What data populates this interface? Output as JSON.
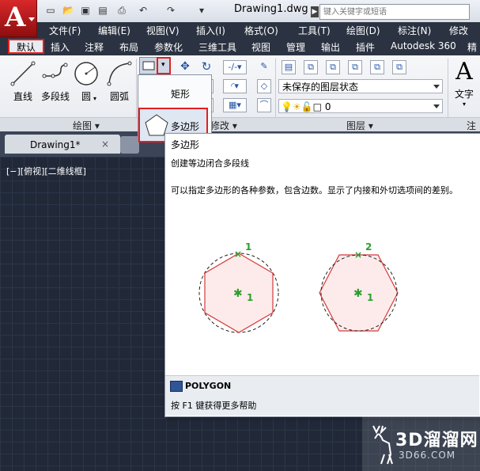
{
  "app": {
    "logo_letter": "A"
  },
  "title_bar": {
    "document_title": "Drawing1.dwg",
    "search_placeholder": "键入关键字或短语"
  },
  "menu": [
    "文件(F)",
    "编辑(E)",
    "视图(V)",
    "插入(I)",
    "格式(O)",
    "工具(T)",
    "绘图(D)",
    "标注(N)",
    "修改(M)"
  ],
  "ribbon_tabs": {
    "active": "默认",
    "others": [
      "插入",
      "注释",
      "布局",
      "参数化",
      "三维工具",
      "视图",
      "管理",
      "输出",
      "插件",
      "Autodesk 360",
      "精"
    ]
  },
  "draw_tools": [
    "直线",
    "多段线",
    "圆",
    "圆弧"
  ],
  "panels": {
    "draw": "绘图",
    "modify": "修改",
    "layers": "层",
    "layer_full": "图层",
    "annotate_short": "注释"
  },
  "layer": {
    "state": "未保存的图层状态",
    "current": "0"
  },
  "text_tool": {
    "letter": "A",
    "label": "文字"
  },
  "dropdown": {
    "rectangle": "矩形",
    "polygon": "多边形"
  },
  "doc_tab": {
    "label": "Drawing1*",
    "close": "×"
  },
  "viewport_label": "[−][俯视][二维线框]",
  "tooltip": {
    "title": "多边形",
    "subtitle": "创建等边闭合多段线",
    "description": "可以指定多边形的各种参数，包含边数。显示了内接和外切选项间的差别。",
    "point_1": "1",
    "point_2": "2",
    "command": "POLYGON",
    "help": "按 F1 键获得更多帮助"
  },
  "watermark": {
    "title": "3D溜溜网",
    "url": "3D66.COM"
  },
  "colors": {
    "accent_red": "#e02020",
    "canvas": "#212939",
    "point_green": "#2e9d2e"
  }
}
